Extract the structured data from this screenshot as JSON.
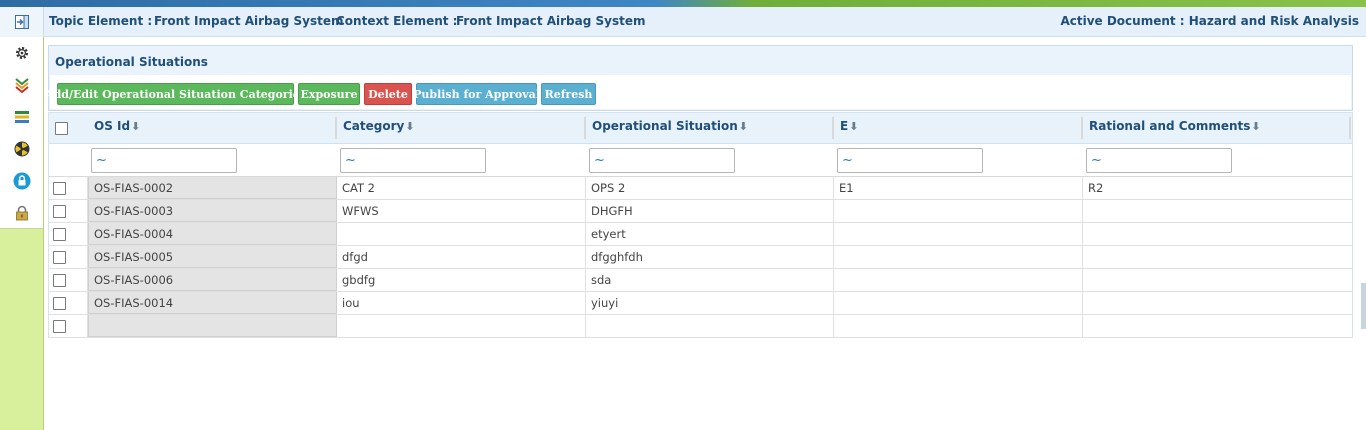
{
  "header": {
    "topic_label": "Topic Element :",
    "topic_value": "Front Impact Airbag System",
    "context_label": "Context Element :",
    "context_value": "Front Impact Airbag System",
    "active_document": "Active Document : Hazard and Risk Analysis"
  },
  "sidebar": {
    "icons": [
      "gear-icon",
      "chevrons-down-icon",
      "layers-icon",
      "radiation-icon",
      "lock-circle-icon",
      "padlock-icon"
    ]
  },
  "panel": {
    "title": "Operational Situations"
  },
  "toolbar": {
    "add_edit": "Add/Edit Operational Situation Categories",
    "exposure": "Exposure",
    "delete": "Delete",
    "publish": "Publish for Approval",
    "refresh": "Refresh",
    "colors": {
      "green": "#5cb85c",
      "red": "#d9534f",
      "blue": "#5bb0d2"
    }
  },
  "grid": {
    "columns": [
      "OS Id",
      "Category",
      "Operational Situation",
      "E",
      "Rational and Comments"
    ],
    "sort_glyph": "⬇",
    "filter_placeholder": "~",
    "rows": [
      {
        "id": "OS-FIAS-0002",
        "category": "CAT 2",
        "situation": "OPS 2",
        "e": "E1",
        "comments": "R2"
      },
      {
        "id": "OS-FIAS-0003",
        "category": "WFWS",
        "situation": "DHGFH",
        "e": "",
        "comments": ""
      },
      {
        "id": "OS-FIAS-0004",
        "category": "",
        "situation": "etyert",
        "e": "",
        "comments": ""
      },
      {
        "id": "OS-FIAS-0005",
        "category": "dfgd",
        "situation": "dfgghfdh",
        "e": "",
        "comments": ""
      },
      {
        "id": "OS-FIAS-0006",
        "category": "gbdfg",
        "situation": "sda",
        "e": "",
        "comments": ""
      },
      {
        "id": "OS-FIAS-0014",
        "category": "iou",
        "situation": "yiuyi",
        "e": "",
        "comments": ""
      },
      {
        "id": "",
        "category": "",
        "situation": "",
        "e": "",
        "comments": ""
      }
    ]
  }
}
